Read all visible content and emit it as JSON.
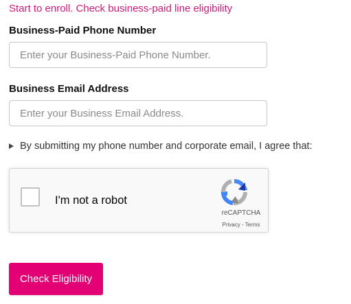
{
  "intro": {
    "text": "Start to enroll. Check business-paid line eligibility"
  },
  "phone": {
    "label": "Business-Paid Phone Number",
    "placeholder": "Enter your Business-Paid Phone Number.",
    "value": ""
  },
  "email": {
    "label": "Business Email Address",
    "placeholder": "Enter your Business Email Address.",
    "value": ""
  },
  "agreement": {
    "text": "By submitting my phone number and corporate email, I agree that:",
    "expanded": false
  },
  "recaptcha": {
    "label": "I'm not a robot",
    "brand": "reCAPTCHA",
    "privacy": "Privacy",
    "separator": " - ",
    "terms": "Terms",
    "checked": false
  },
  "submit": {
    "label": "Check Eligibility"
  },
  "colors": {
    "accent": "#e20074",
    "link": "#d0187a"
  }
}
